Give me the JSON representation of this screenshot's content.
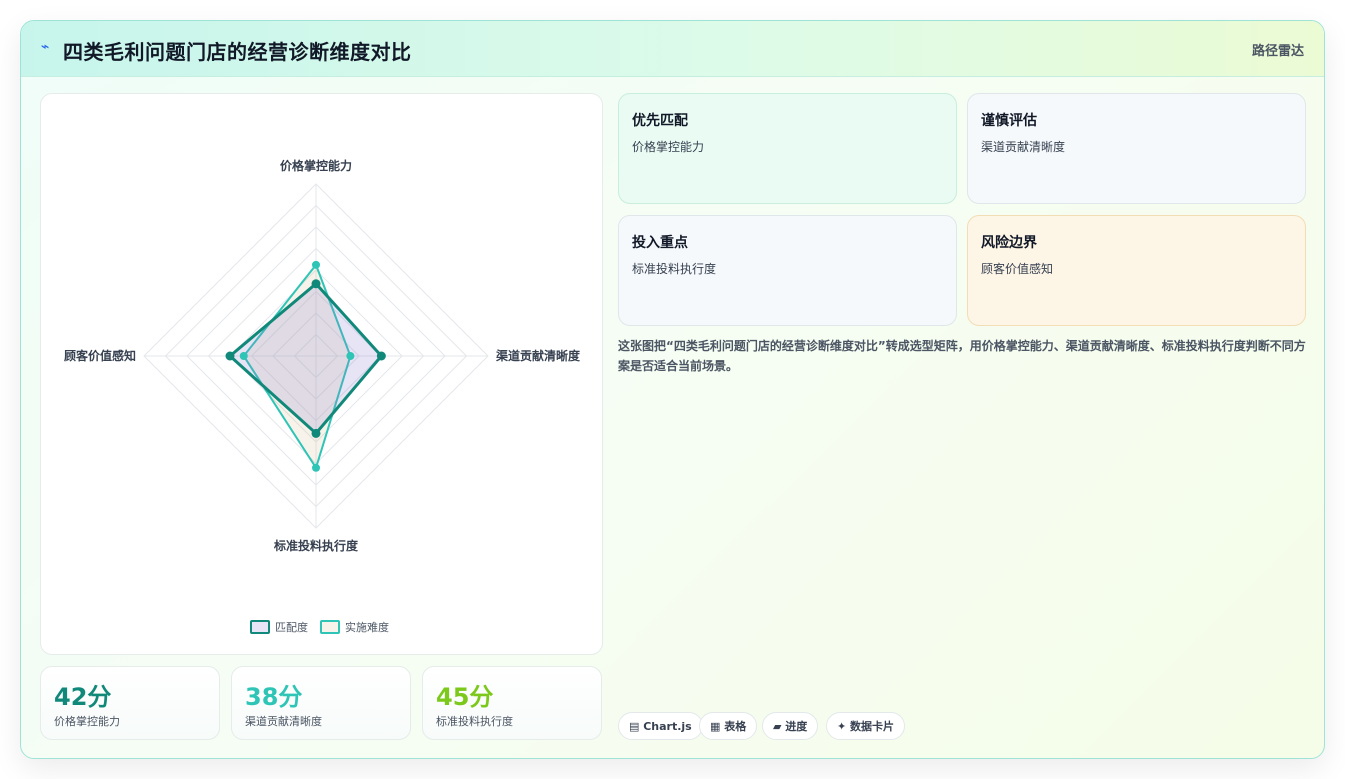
{
  "header": {
    "icon": "lightning-icon",
    "title": "四类毛利问题门店的经营诊断维度对比",
    "tag": "路径雷达"
  },
  "chart_data": {
    "type": "radar",
    "axes": [
      "价格掌控能力",
      "渠道贡献清晰度",
      "标准投料执行度",
      "顾客价值感知"
    ],
    "rmax": 100,
    "series": [
      {
        "name": "匹配度",
        "values": [
          42,
          38,
          45,
          50
        ],
        "color": "#11897a"
      },
      {
        "name": "实施难度",
        "values": [
          53,
          20,
          65,
          42
        ],
        "color": "#2ec4b6"
      }
    ]
  },
  "stats": [
    {
      "value": "42分",
      "label": "价格掌控能力",
      "color": "#11897a"
    },
    {
      "value": "38分",
      "label": "渠道贡献清晰度",
      "color": "#2ec4b6"
    },
    {
      "value": "45分",
      "label": "标准投料执行度",
      "color": "#7cc91b"
    }
  ],
  "boxes": [
    {
      "title": "优先匹配",
      "body": "价格掌控能力"
    },
    {
      "title": "谨慎评估",
      "body": "渠道贡献清晰度"
    },
    {
      "title": "投入重点",
      "body": "标准投料执行度"
    },
    {
      "title": "风险边界",
      "body": "顾客价值感知"
    }
  ],
  "description": "这张图把“四类毛利问题门店的经营诊断维度对比”转成选型矩阵，用价格掌控能力、渠道贡献清晰度、标准投料执行度判断不同方案是否适合当前场景。",
  "chips": [
    {
      "icon": "chart-icon",
      "label": "▤ Chart.js"
    },
    {
      "icon": "table-icon",
      "label": "▦ 表格"
    },
    {
      "icon": "progress-icon",
      "label": "▰ 进度"
    },
    {
      "icon": "sparkle-icon",
      "label": "✦ 数据卡片"
    }
  ]
}
